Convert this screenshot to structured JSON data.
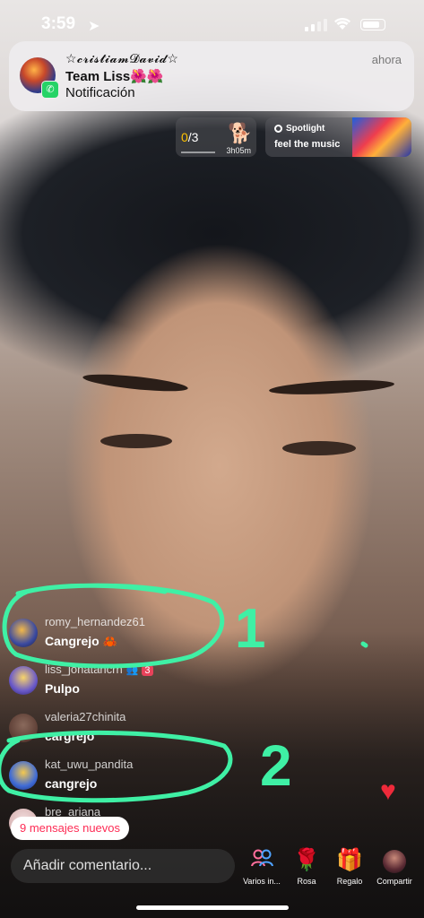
{
  "status": {
    "time": "3:59"
  },
  "notification": {
    "sender": "☆𝓬𝓻𝓲𝓼𝓽𝓲𝓪𝓶𝓓𝓪𝓿𝓲𝓭☆",
    "title": "Team Liss🌺🌺",
    "body": "Notificación",
    "time": "ahora",
    "app_icon": "whatsapp-icon"
  },
  "goal": {
    "current": "0",
    "total": "/3",
    "timer": "3h05m"
  },
  "spotlight": {
    "label": "Spotlight",
    "text": "feel the music"
  },
  "chat": [
    {
      "user": "romy_hernandez61",
      "text": "Cangrejo",
      "emoji": "🦀",
      "avatar_color": "#3b4aa0"
    },
    {
      "user": "liss_jonatancrh",
      "text": "Pulpo",
      "badge": "3",
      "avatar_color": "#6a59c9"
    },
    {
      "user": "valeria27chinita",
      "text": "cargrejo",
      "avatar_color": "#5c3d34"
    },
    {
      "user": "kat_uwu_pandita",
      "text": "cangrejo",
      "avatar_color": "#3f6bd6"
    },
    {
      "user": "bre_ariana",
      "text": "",
      "avatar_color": "#d7b3b3"
    }
  ],
  "new_messages": "9 mensajes nuevos",
  "annotations": {
    "one": "1",
    "two": "2"
  },
  "bottom": {
    "comment_placeholder": "Añadir comentario...",
    "actions": [
      {
        "label": "Varios in...",
        "icon": "people-icon"
      },
      {
        "label": "Rosa",
        "icon": "rose-icon"
      },
      {
        "label": "Regalo",
        "icon": "gift-icon"
      },
      {
        "label": "Compartir",
        "icon": "share-avatar-icon"
      }
    ]
  },
  "colors": {
    "accent": "#fe2c55",
    "annotation": "#3ff0a5",
    "heart": "#ee2a3a"
  }
}
